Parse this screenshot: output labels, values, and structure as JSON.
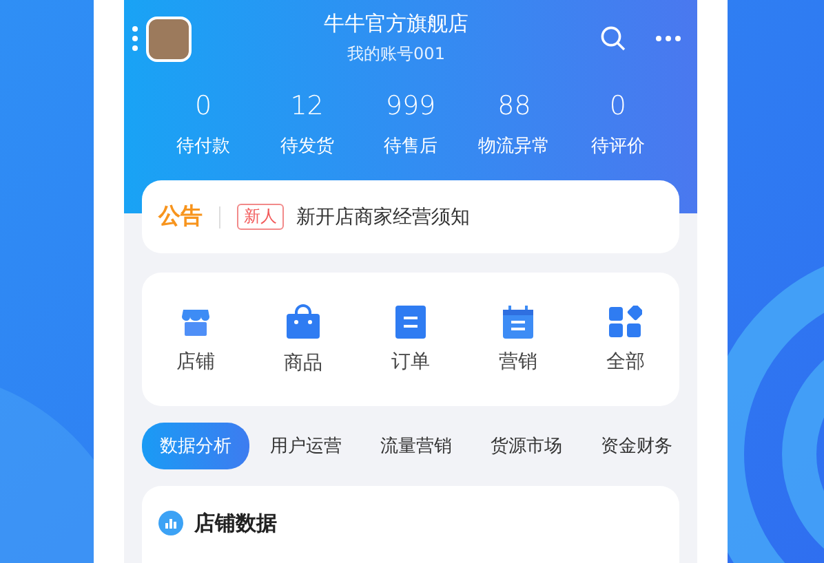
{
  "header": {
    "shop_name": "牛牛官方旗舰店",
    "account": "我的账号001"
  },
  "stats": [
    {
      "value": "0",
      "label": "待付款"
    },
    {
      "value": "12",
      "label": "待发货"
    },
    {
      "value": "999",
      "label": "待售后"
    },
    {
      "value": "88",
      "label": "物流异常"
    },
    {
      "value": "0",
      "label": "待评价"
    }
  ],
  "notice": {
    "title": "公告",
    "badge": "新人",
    "text": "新开店商家经营须知"
  },
  "shortcuts": [
    {
      "kind": "store",
      "label": "店铺"
    },
    {
      "kind": "bag",
      "label": "商品"
    },
    {
      "kind": "order",
      "label": "订单"
    },
    {
      "kind": "calendar",
      "label": "营销"
    },
    {
      "kind": "grid",
      "label": "全部"
    }
  ],
  "tabs": [
    {
      "label": "数据分析",
      "selected": true
    },
    {
      "label": "用户运营",
      "selected": false
    },
    {
      "label": "流量营销",
      "selected": false
    },
    {
      "label": "货源市场",
      "selected": false
    },
    {
      "label": "资金财务",
      "selected": false
    }
  ],
  "section": {
    "title": "店铺数据"
  }
}
